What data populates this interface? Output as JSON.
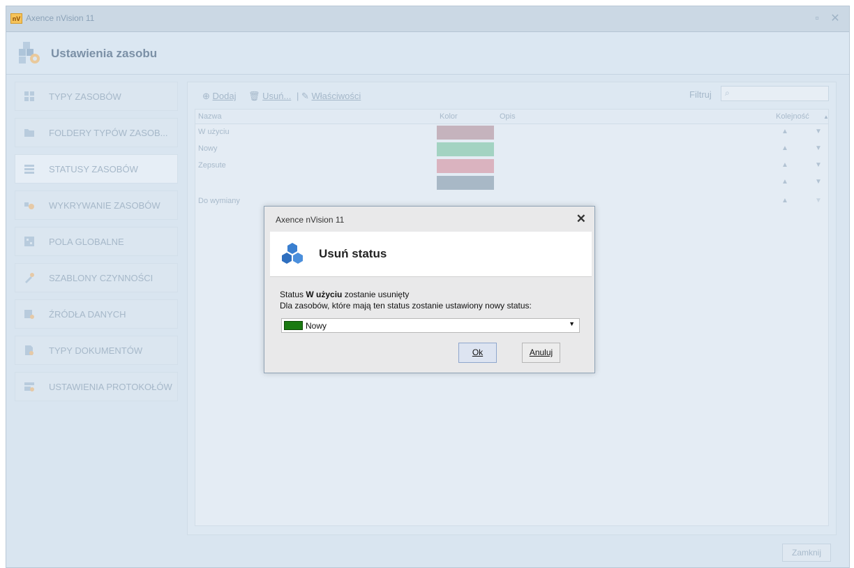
{
  "window": {
    "title": "Axence nVision 11",
    "logo": "nV"
  },
  "header": {
    "title": "Ustawienia zasobu",
    "icon": "assets-settings-icon"
  },
  "sidebar": {
    "items": [
      {
        "label": "TYPY ZASOBÓW",
        "icon": "asset-types-icon"
      },
      {
        "label": "FOLDERY TYPÓW ZASOB...",
        "icon": "folder-icon"
      },
      {
        "label": "STATUSY ZASOBÓW",
        "icon": "statuses-icon"
      },
      {
        "label": "WYKRYWANIE ZASOBÓW",
        "icon": "discovery-icon"
      },
      {
        "label": "POLA GLOBALNE",
        "icon": "global-fields-icon"
      },
      {
        "label": "SZABLONY CZYNNOŚCI",
        "icon": "tools-icon"
      },
      {
        "label": "ŹRÓDŁA DANYCH",
        "icon": "data-sources-icon"
      },
      {
        "label": "TYPY DOKUMENTÓW",
        "icon": "document-types-icon"
      },
      {
        "label": "USTAWIENIA PROTOKOŁÓW",
        "icon": "protocols-icon"
      }
    ]
  },
  "toolbar": {
    "add": "Dodaj",
    "delete": "Usuń...",
    "properties": "Właściwości",
    "filter_label": "Filtruj"
  },
  "grid": {
    "columns": [
      "Nazwa",
      "Kolor",
      "Opis",
      "Kolejność"
    ],
    "rows": [
      {
        "name": "W użyciu",
        "color": "#c5b3bd"
      },
      {
        "name": "Nowy",
        "color": "#a3d3c2"
      },
      {
        "name": "Zepsute",
        "color": "#dab3bf"
      },
      {
        "name": "",
        "color": "#a8b8c6"
      },
      {
        "name": "Do wymiany",
        "color": ""
      }
    ]
  },
  "footer": {
    "close": "Zamknij"
  },
  "dialog": {
    "title": "Axence nVision 11",
    "heading": "Usuń status",
    "msg_prefix": "Status ",
    "msg_status": "W użyciu",
    "msg_suffix": " zostanie usunięty",
    "msg_line2": "Dla zasobów, które mają ten status zostanie ustawiony nowy status:",
    "select_value": "Nowy",
    "select_color": "#1a7a12",
    "ok": "Ok",
    "cancel": "Anuluj"
  }
}
